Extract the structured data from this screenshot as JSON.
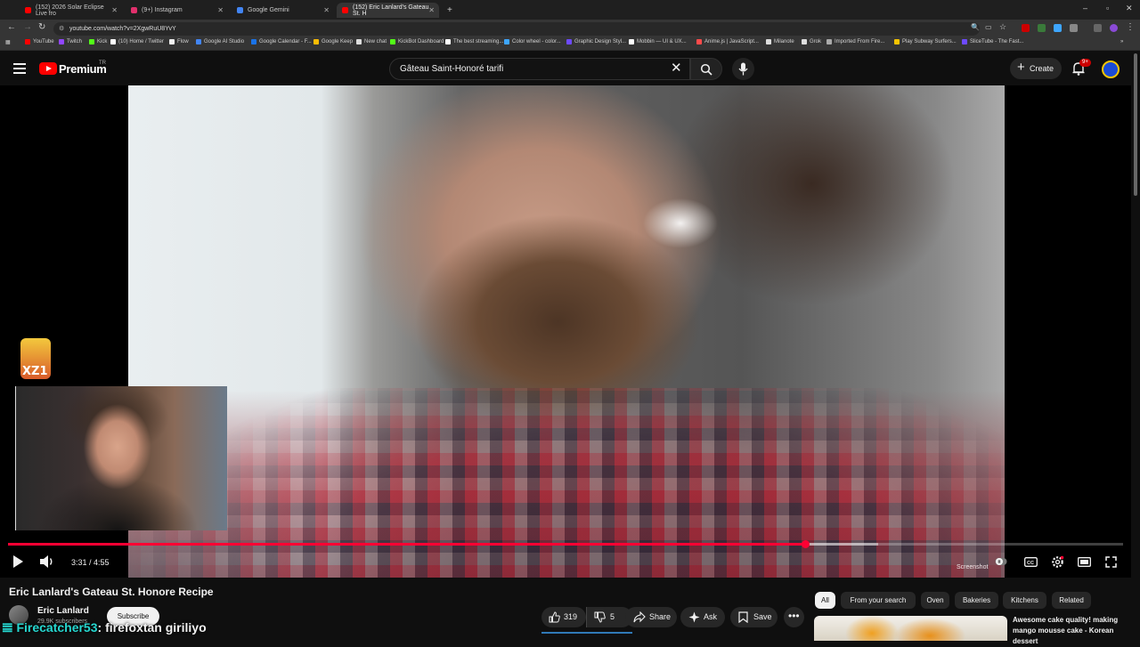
{
  "browser": {
    "tabs": [
      {
        "title": "(152) 2026 Solar Eclipse Live fro",
        "favicon_color": "#ff0000",
        "active": false
      },
      {
        "title": "(9+) Instagram",
        "favicon_color": "#e1306c",
        "active": false
      },
      {
        "title": "Google Gemini",
        "favicon_color": "#4285f4",
        "active": false
      },
      {
        "title": "(152) Eric Lanlard's Gateau St. H",
        "favicon_color": "#ff0000",
        "active": true
      }
    ],
    "new_tab_label": "+",
    "url": "youtube.com/watch?v=2XgwRuU8YvY",
    "bookmarks": [
      {
        "label": "YouTube",
        "color": "#ff0000"
      },
      {
        "label": "Twitch",
        "color": "#9146ff"
      },
      {
        "label": "Kick",
        "color": "#53fc18"
      },
      {
        "label": "(10) Home / Twitter",
        "color": "#ffffff"
      },
      {
        "label": "Flow",
        "color": "#f1f1f1"
      },
      {
        "label": "Google AI Studio",
        "color": "#4285f4"
      },
      {
        "label": "Google Calendar - F...",
        "color": "#1a73e8"
      },
      {
        "label": "Google Keep",
        "color": "#fbbc04"
      },
      {
        "label": "New chat",
        "color": "#dddddd"
      },
      {
        "label": "KickBot Dashboard",
        "color": "#53fc18"
      },
      {
        "label": "The best streaming...",
        "color": "#ffffff"
      },
      {
        "label": "Color wheel - color...",
        "color": "#3ea6ff"
      },
      {
        "label": "Graphic Design Styl...",
        "color": "#6d4aff"
      },
      {
        "label": "Mobbin — UI & UX...",
        "color": "#ffffff"
      },
      {
        "label": "Anime.js | JavaScript...",
        "color": "#ff4b4b"
      },
      {
        "label": "Milanote",
        "color": "#dddddd"
      },
      {
        "label": "Grok",
        "color": "#dddddd"
      },
      {
        "label": "Imported From Fire...",
        "color": "#aaaaaa"
      },
      {
        "label": "Play Subway Surfers...",
        "color": "#f5c400"
      },
      {
        "label": "SliceTube - The Fast...",
        "color": "#6d4aff"
      }
    ]
  },
  "header": {
    "brand": "Premium",
    "country": "TR",
    "search_query": "Gâteau Saint-Honoré tarifi",
    "create_label": "Create",
    "notification_count": "9+"
  },
  "player": {
    "current_time": "3:31",
    "duration": "4:55",
    "time_display": "3:31 / 4:55",
    "progress_fraction": 0.715,
    "buffered_fraction": 0.78,
    "screenshot_label": "Screenshot",
    "overlay_badge": "XZ1"
  },
  "video": {
    "title": "Eric Lanlard's Gateau St. Honore Recipe",
    "channel": "Eric Lanlard",
    "subscribers": "29.9K subscribers",
    "subscribe_label": "Subscribe",
    "likes": "319",
    "dislikes": "5",
    "share_label": "Share",
    "ask_label": "Ask",
    "save_label": "Save"
  },
  "chat_overlay": {
    "user": "Firecatcher53",
    "message": ": firefoxtan giriliyo"
  },
  "chips": [
    "All",
    "From your search",
    "Oven",
    "Bakeries",
    "Kitchens",
    "Related"
  ],
  "recommendation": {
    "title": "Awesome cake quality! making mango mousse cake - Korean dessert"
  },
  "colors": {
    "youtube_red": "#ff0000",
    "progress_red": "#ff0033",
    "background": "#0f0f0f"
  }
}
